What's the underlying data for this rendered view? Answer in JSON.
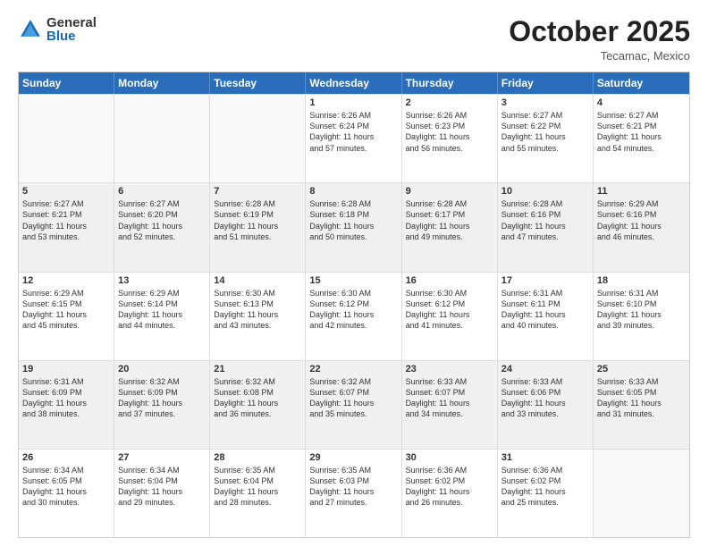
{
  "logo": {
    "general": "General",
    "blue": "Blue"
  },
  "title": "October 2025",
  "subtitle": "Tecamac, Mexico",
  "days": [
    "Sunday",
    "Monday",
    "Tuesday",
    "Wednesday",
    "Thursday",
    "Friday",
    "Saturday"
  ],
  "weeks": [
    [
      {
        "day": "",
        "lines": []
      },
      {
        "day": "",
        "lines": []
      },
      {
        "day": "",
        "lines": []
      },
      {
        "day": "1",
        "lines": [
          "Sunrise: 6:26 AM",
          "Sunset: 6:24 PM",
          "Daylight: 11 hours",
          "and 57 minutes."
        ]
      },
      {
        "day": "2",
        "lines": [
          "Sunrise: 6:26 AM",
          "Sunset: 6:23 PM",
          "Daylight: 11 hours",
          "and 56 minutes."
        ]
      },
      {
        "day": "3",
        "lines": [
          "Sunrise: 6:27 AM",
          "Sunset: 6:22 PM",
          "Daylight: 11 hours",
          "and 55 minutes."
        ]
      },
      {
        "day": "4",
        "lines": [
          "Sunrise: 6:27 AM",
          "Sunset: 6:21 PM",
          "Daylight: 11 hours",
          "and 54 minutes."
        ]
      }
    ],
    [
      {
        "day": "5",
        "lines": [
          "Sunrise: 6:27 AM",
          "Sunset: 6:21 PM",
          "Daylight: 11 hours",
          "and 53 minutes."
        ]
      },
      {
        "day": "6",
        "lines": [
          "Sunrise: 6:27 AM",
          "Sunset: 6:20 PM",
          "Daylight: 11 hours",
          "and 52 minutes."
        ]
      },
      {
        "day": "7",
        "lines": [
          "Sunrise: 6:28 AM",
          "Sunset: 6:19 PM",
          "Daylight: 11 hours",
          "and 51 minutes."
        ]
      },
      {
        "day": "8",
        "lines": [
          "Sunrise: 6:28 AM",
          "Sunset: 6:18 PM",
          "Daylight: 11 hours",
          "and 50 minutes."
        ]
      },
      {
        "day": "9",
        "lines": [
          "Sunrise: 6:28 AM",
          "Sunset: 6:17 PM",
          "Daylight: 11 hours",
          "and 49 minutes."
        ]
      },
      {
        "day": "10",
        "lines": [
          "Sunrise: 6:28 AM",
          "Sunset: 6:16 PM",
          "Daylight: 11 hours",
          "and 47 minutes."
        ]
      },
      {
        "day": "11",
        "lines": [
          "Sunrise: 6:29 AM",
          "Sunset: 6:16 PM",
          "Daylight: 11 hours",
          "and 46 minutes."
        ]
      }
    ],
    [
      {
        "day": "12",
        "lines": [
          "Sunrise: 6:29 AM",
          "Sunset: 6:15 PM",
          "Daylight: 11 hours",
          "and 45 minutes."
        ]
      },
      {
        "day": "13",
        "lines": [
          "Sunrise: 6:29 AM",
          "Sunset: 6:14 PM",
          "Daylight: 11 hours",
          "and 44 minutes."
        ]
      },
      {
        "day": "14",
        "lines": [
          "Sunrise: 6:30 AM",
          "Sunset: 6:13 PM",
          "Daylight: 11 hours",
          "and 43 minutes."
        ]
      },
      {
        "day": "15",
        "lines": [
          "Sunrise: 6:30 AM",
          "Sunset: 6:12 PM",
          "Daylight: 11 hours",
          "and 42 minutes."
        ]
      },
      {
        "day": "16",
        "lines": [
          "Sunrise: 6:30 AM",
          "Sunset: 6:12 PM",
          "Daylight: 11 hours",
          "and 41 minutes."
        ]
      },
      {
        "day": "17",
        "lines": [
          "Sunrise: 6:31 AM",
          "Sunset: 6:11 PM",
          "Daylight: 11 hours",
          "and 40 minutes."
        ]
      },
      {
        "day": "18",
        "lines": [
          "Sunrise: 6:31 AM",
          "Sunset: 6:10 PM",
          "Daylight: 11 hours",
          "and 39 minutes."
        ]
      }
    ],
    [
      {
        "day": "19",
        "lines": [
          "Sunrise: 6:31 AM",
          "Sunset: 6:09 PM",
          "Daylight: 11 hours",
          "and 38 minutes."
        ]
      },
      {
        "day": "20",
        "lines": [
          "Sunrise: 6:32 AM",
          "Sunset: 6:09 PM",
          "Daylight: 11 hours",
          "and 37 minutes."
        ]
      },
      {
        "day": "21",
        "lines": [
          "Sunrise: 6:32 AM",
          "Sunset: 6:08 PM",
          "Daylight: 11 hours",
          "and 36 minutes."
        ]
      },
      {
        "day": "22",
        "lines": [
          "Sunrise: 6:32 AM",
          "Sunset: 6:07 PM",
          "Daylight: 11 hours",
          "and 35 minutes."
        ]
      },
      {
        "day": "23",
        "lines": [
          "Sunrise: 6:33 AM",
          "Sunset: 6:07 PM",
          "Daylight: 11 hours",
          "and 34 minutes."
        ]
      },
      {
        "day": "24",
        "lines": [
          "Sunrise: 6:33 AM",
          "Sunset: 6:06 PM",
          "Daylight: 11 hours",
          "and 33 minutes."
        ]
      },
      {
        "day": "25",
        "lines": [
          "Sunrise: 6:33 AM",
          "Sunset: 6:05 PM",
          "Daylight: 11 hours",
          "and 31 minutes."
        ]
      }
    ],
    [
      {
        "day": "26",
        "lines": [
          "Sunrise: 6:34 AM",
          "Sunset: 6:05 PM",
          "Daylight: 11 hours",
          "and 30 minutes."
        ]
      },
      {
        "day": "27",
        "lines": [
          "Sunrise: 6:34 AM",
          "Sunset: 6:04 PM",
          "Daylight: 11 hours",
          "and 29 minutes."
        ]
      },
      {
        "day": "28",
        "lines": [
          "Sunrise: 6:35 AM",
          "Sunset: 6:04 PM",
          "Daylight: 11 hours",
          "and 28 minutes."
        ]
      },
      {
        "day": "29",
        "lines": [
          "Sunrise: 6:35 AM",
          "Sunset: 6:03 PM",
          "Daylight: 11 hours",
          "and 27 minutes."
        ]
      },
      {
        "day": "30",
        "lines": [
          "Sunrise: 6:36 AM",
          "Sunset: 6:02 PM",
          "Daylight: 11 hours",
          "and 26 minutes."
        ]
      },
      {
        "day": "31",
        "lines": [
          "Sunrise: 6:36 AM",
          "Sunset: 6:02 PM",
          "Daylight: 11 hours",
          "and 25 minutes."
        ]
      },
      {
        "day": "",
        "lines": []
      }
    ]
  ]
}
